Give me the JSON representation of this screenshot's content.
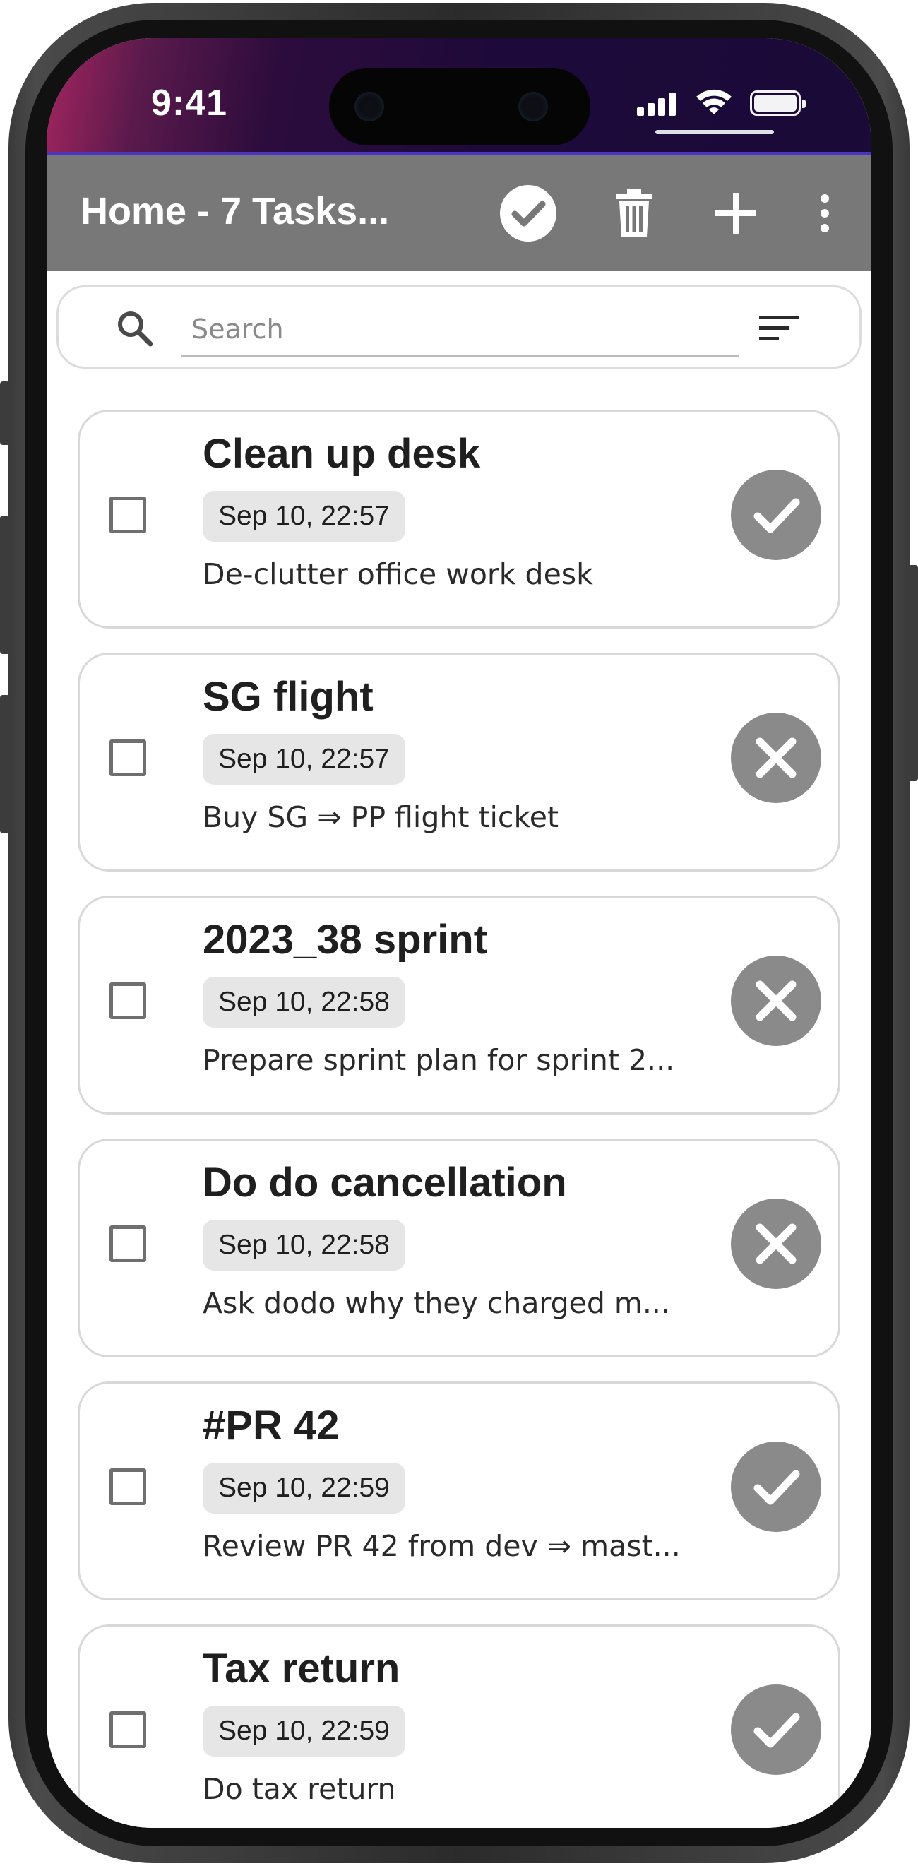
{
  "status_bar": {
    "time": "9:41",
    "icons": [
      "signal-icon",
      "wifi-icon",
      "battery-icon"
    ]
  },
  "app_bar": {
    "title": "Home - 7 Tasks...",
    "actions": [
      "complete-all-icon",
      "trash-icon",
      "add-icon",
      "more-vert-icon"
    ],
    "background": "#787878"
  },
  "search": {
    "placeholder": "Search",
    "value": ""
  },
  "tasks": [
    {
      "title": "Clean up desk",
      "date": "Sep 10, 22:57",
      "description": "De-clutter office work desk",
      "status": "done"
    },
    {
      "title": "SG flight",
      "date": "Sep 10, 22:57",
      "description": "Buy SG ⇒ PP flight ticket",
      "status": "not-done"
    },
    {
      "title": "2023_38 sprint",
      "date": "Sep 10, 22:58",
      "description": "Prepare sprint plan for sprint 2...",
      "status": "not-done"
    },
    {
      "title": "Do do cancellation",
      "date": "Sep 10, 22:58",
      "description": "Ask dodo why they charged m...",
      "status": "not-done"
    },
    {
      "title": "#PR 42",
      "date": "Sep 10, 22:59",
      "description": "Review PR 42 from dev ⇒ mast...",
      "status": "done"
    },
    {
      "title": "Tax return",
      "date": "Sep 10, 22:59",
      "description": "Do tax return",
      "status": "done"
    }
  ],
  "colors": {
    "status_gradient_start": "#a4255f",
    "status_gradient_end": "#1a0a38",
    "accent_line": "#4a35c4",
    "status_button": "#8a8a8a"
  }
}
